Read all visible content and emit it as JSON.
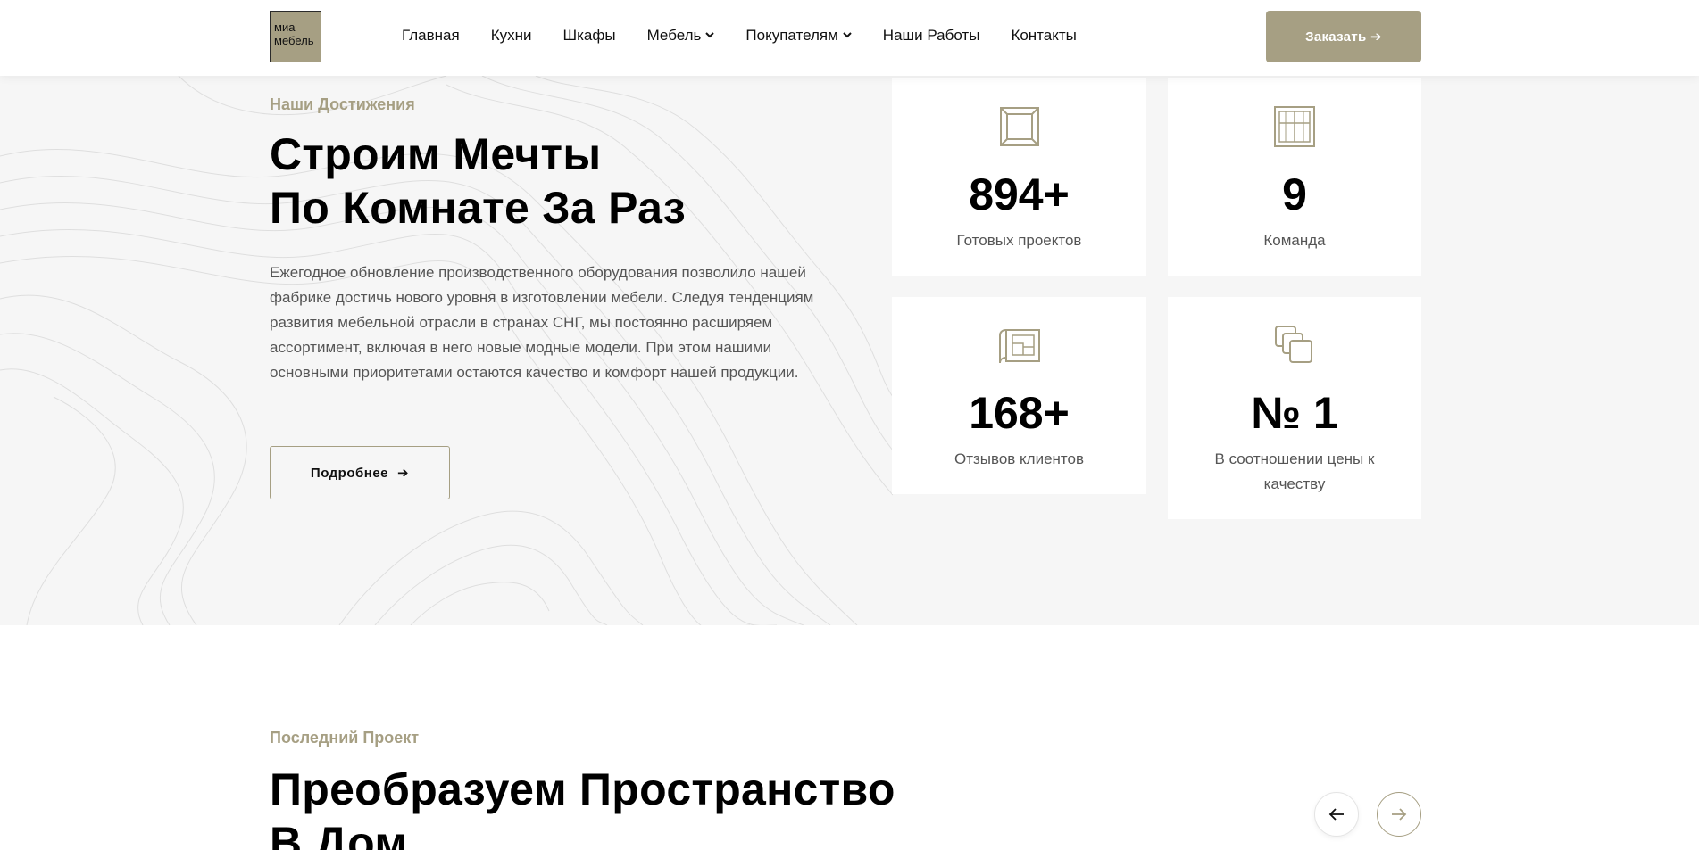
{
  "header": {
    "logo_line1": "миа",
    "logo_line2": "мебель",
    "nav": [
      "Главная",
      "Кухни",
      "Шкафы",
      "Мебель",
      "Покупателям",
      "Наши Работы",
      "Контакты"
    ],
    "order_button": "Заказать ➔"
  },
  "achievements": {
    "tag": "Наши Достижения",
    "title_line1": "Строим Мечты",
    "title_line2": "По Комнате За Раз",
    "description": "Ежегодное обновление производственного оборудования позволило нашей фабрике достичь нового уровня в изготовлении мебели. Следуя тенденциям развития мебельной отрасли в странах СНГ, мы постоянно расширяем ассортимент, включая в него новые модные модели. При этом нашими основными приоритетами остаются качество и комфорт нашей продукции.",
    "more_button": "Подробнее",
    "stats": [
      {
        "icon": "frame-icon",
        "value": "894+",
        "label": "Готовых проектов"
      },
      {
        "icon": "window-icon",
        "value": "9",
        "label": "Команда"
      },
      {
        "icon": "blueprint-icon",
        "value": "168+",
        "label": "Отзывов клиентов"
      },
      {
        "icon": "layers-icon",
        "value": "№ 1",
        "label": "В соотношении цены к качеству"
      }
    ]
  },
  "project": {
    "tag": "Последний Проект",
    "title_line1": "Преобразуем Пространство",
    "title_line2": "В Дом"
  },
  "colors": {
    "accent": "#a69f83",
    "section_bg": "#f6f6f6",
    "text_muted": "#555555"
  }
}
